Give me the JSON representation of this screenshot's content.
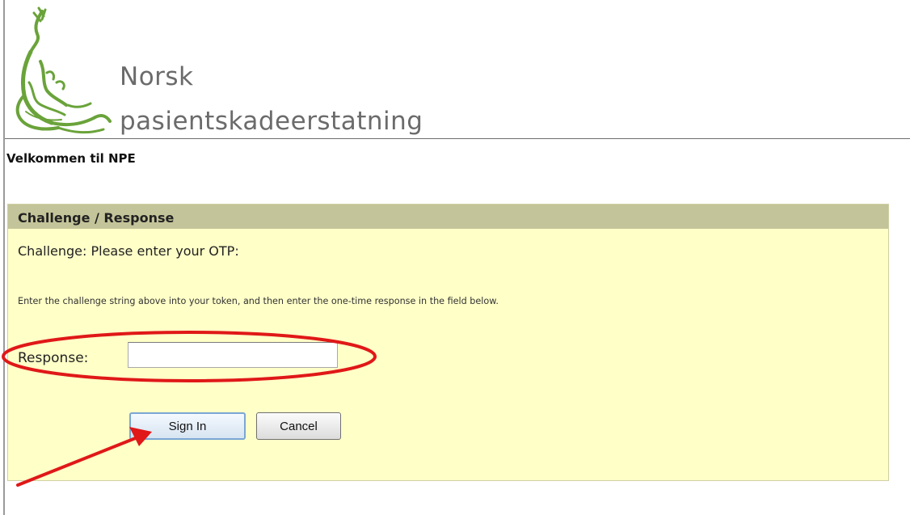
{
  "header": {
    "org_name_line1": "Norsk",
    "org_name_line2": "pasientskadeerstatning",
    "logo_icon": "npe-logo-icon"
  },
  "welcome": {
    "text": "Velkommen til NPE"
  },
  "panel": {
    "title": "Challenge / Response",
    "challenge_text": "Challenge: Please enter your OTP:",
    "instructions": "Enter the challenge string above into your token, and then enter the one-time response in the field below.",
    "response_label": "Response:",
    "response_value": "",
    "sign_in_label": "Sign In",
    "cancel_label": "Cancel"
  },
  "colors": {
    "panel_background": "#ffffc8",
    "panel_header": "#c4c49a",
    "annotation_red": "#e01818",
    "logo_green": "#6aa33a",
    "org_text": "#6b6b6b"
  },
  "annotations": {
    "highlight_icon": "red-ellipse-highlight",
    "arrow_icon": "red-arrow"
  }
}
